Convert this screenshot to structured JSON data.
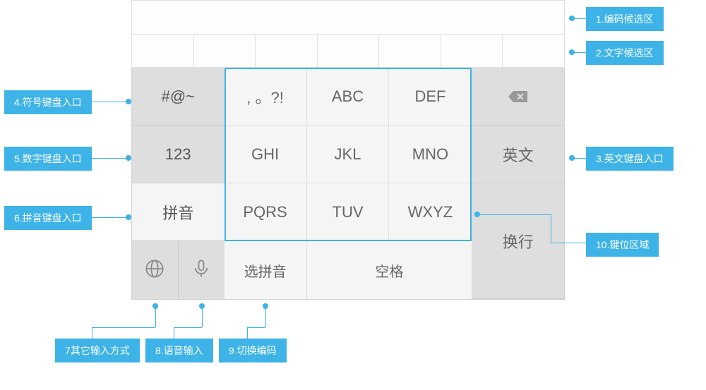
{
  "labels": {
    "l1": "1.编码候选区",
    "l2": "2.文字候选区",
    "l3": "3.英文键盘入口",
    "l4": "4.符号键盘入口",
    "l5": "5.数字键盘入口",
    "l6": "6.拼音键盘入口",
    "l7": "7其它输入方式",
    "l8": "8.语音输入",
    "l9": "9.切换编码",
    "l10": "10.键位区域"
  },
  "keys": {
    "symbol": "#@~",
    "number": "123",
    "pinyin": "拼音",
    "grid": [
      [
        ", 。?!",
        "ABC",
        "DEF"
      ],
      [
        "GHI",
        "JKL",
        "MNO"
      ],
      [
        "PQRS",
        "TUV",
        "WXYZ"
      ]
    ],
    "select_pinyin": "选拼音",
    "space": "空格",
    "english": "英文",
    "enter": "换行"
  }
}
